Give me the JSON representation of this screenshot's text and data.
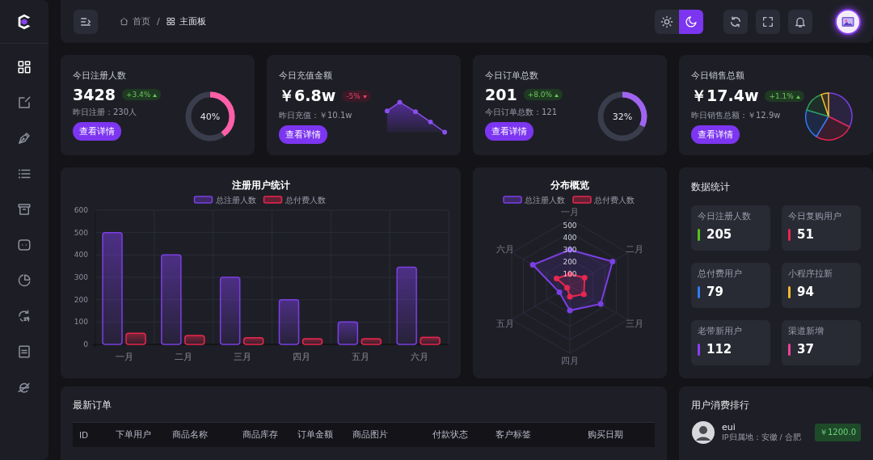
{
  "sidebar": {
    "items": [
      {
        "selected": true
      },
      {
        "selected": false
      },
      {
        "selected": false
      },
      {
        "selected": false
      },
      {
        "selected": false
      },
      {
        "selected": false
      },
      {
        "selected": false
      },
      {
        "selected": false
      },
      {
        "selected": false
      },
      {
        "selected": false
      }
    ]
  },
  "header": {
    "breadcrumb": {
      "items": [
        "首页",
        "主面板"
      ],
      "separator": "/"
    },
    "theme": [
      {
        "selected": false
      },
      {
        "selected": true
      }
    ]
  },
  "stat_cards": [
    {
      "title": "今日注册人数",
      "value": "3428",
      "change": "+3.4%",
      "kind": "up",
      "sub": "昨日注册：230人",
      "button": "查看详情",
      "chart": {
        "kind": "ring",
        "level": 0.4,
        "reading": "40%",
        "color": "#ff5fa8"
      }
    },
    {
      "title": "今日充值金额",
      "value": "￥6.8w",
      "change": "-5%",
      "kind": "down",
      "sub": "昨日充值：￥10.1w",
      "button": "查看详情",
      "chart": {
        "kind": "sparkline"
      }
    },
    {
      "title": "今日订单总数",
      "value": "201",
      "change": "+8.0%",
      "kind": "up",
      "sub": "今日订单总数：121",
      "button": "查看详情",
      "chart": {
        "kind": "ring",
        "level": 0.32,
        "reading": "32%",
        "color": "#a064f0"
      }
    },
    {
      "title": "今日销售总额",
      "value": "￥17.4w",
      "change": "+1.1%",
      "kind": "up",
      "sub": "昨日销售总额：￥12.9w",
      "button": "查看详情",
      "chart": {
        "kind": "pie"
      }
    }
  ],
  "bar_panel": {
    "chart_data": {
      "type": "bar",
      "title": "注册用户统计",
      "categories": [
        "一月",
        "二月",
        "三月",
        "四月",
        "五月",
        "六月"
      ],
      "series": [
        {
          "name": "总注册人数",
          "color": "#7b3fe4",
          "values": [
            500,
            400,
            300,
            200,
            100,
            345
          ]
        },
        {
          "name": "总付费人数",
          "color": "#e8264f",
          "values": [
            50,
            40,
            30,
            25,
            25,
            32
          ]
        }
      ],
      "ylim": [
        0,
        600
      ],
      "yticks": [
        0,
        100,
        200,
        300,
        400,
        500,
        600
      ],
      "grid": true,
      "legend": true
    }
  },
  "radar_panel": {
    "title": "分布概览",
    "legend": [
      {
        "name": "总注册人数",
        "color": "#7b3fe4"
      },
      {
        "name": "总付费人数",
        "color": "#e8264f"
      }
    ],
    "axes": [
      "一月",
      "二月",
      "三月",
      "四月",
      "五月",
      "六月"
    ],
    "ticks": [
      "500",
      "400",
      "300",
      "200",
      "100"
    ]
  },
  "data_stats": {
    "title": "数据统计",
    "items": [
      {
        "label": "今日注册人数",
        "value": "205",
        "color": "#52c41a"
      },
      {
        "label": "今日复购用户",
        "value": "51",
        "color": "#e8264f"
      },
      {
        "label": "总付费用户",
        "value": "79",
        "color": "#2f7bf5"
      },
      {
        "label": "小程序拉新",
        "value": "94",
        "color": "#f5b82e"
      },
      {
        "label": "老带新用户",
        "value": "112",
        "color": "#8a3ff0"
      },
      {
        "label": "渠道新增",
        "value": "37",
        "color": "#f0409a"
      }
    ]
  },
  "orders": {
    "title": "最新订单",
    "columns": [
      "ID",
      "下单用户",
      "商品名称",
      "商品库存",
      "订单金额",
      "商品图片",
      "付款状态",
      "客户标签",
      "购买日期"
    ]
  },
  "ranking": {
    "title": "用户消费排行",
    "users": [
      {
        "name": "eui",
        "location": "IP归属地：安徽 / 合肥",
        "amount": "￥1200.0"
      }
    ]
  }
}
